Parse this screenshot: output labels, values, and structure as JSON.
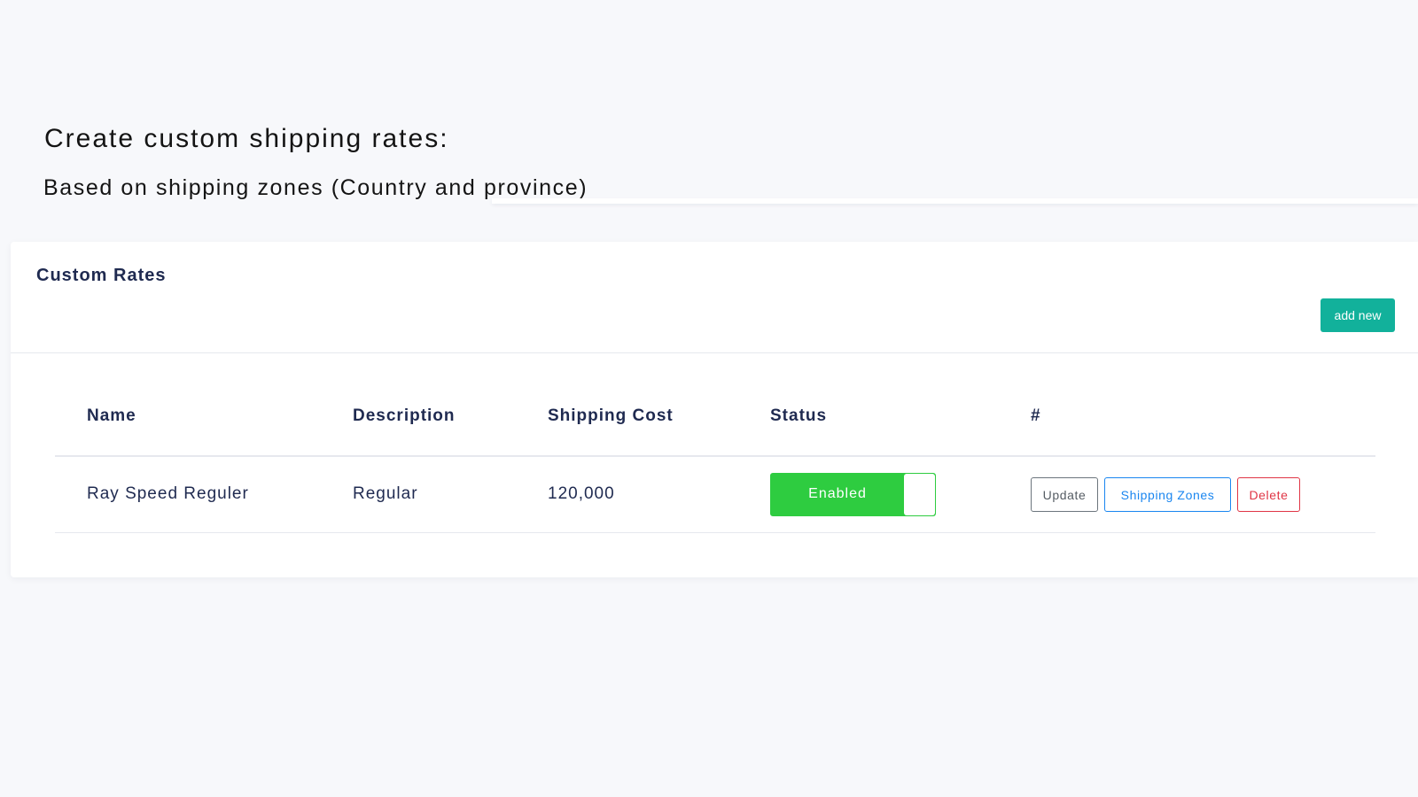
{
  "intro": {
    "headline": "Create custom shipping rates:",
    "subline": "Based on shipping zones (Country and province)"
  },
  "card": {
    "title": "Custom Rates",
    "add_button_label": "add new"
  },
  "table": {
    "columns": [
      "Name",
      "Description",
      "Shipping Cost",
      "Status",
      "#"
    ],
    "rows": [
      {
        "name": "Ray Speed Reguler",
        "description": "Regular",
        "shipping_cost": "120,000",
        "status_label": "Enabled",
        "actions": {
          "update": "Update",
          "shipping_zones": "Shipping Zones",
          "delete": "Delete"
        }
      }
    ]
  },
  "colors": {
    "accent_teal": "#12b19b",
    "status_green": "#2ecc40",
    "update_gray": "#6c757d",
    "zones_blue": "#1a86f0",
    "delete_red": "#e03545"
  }
}
